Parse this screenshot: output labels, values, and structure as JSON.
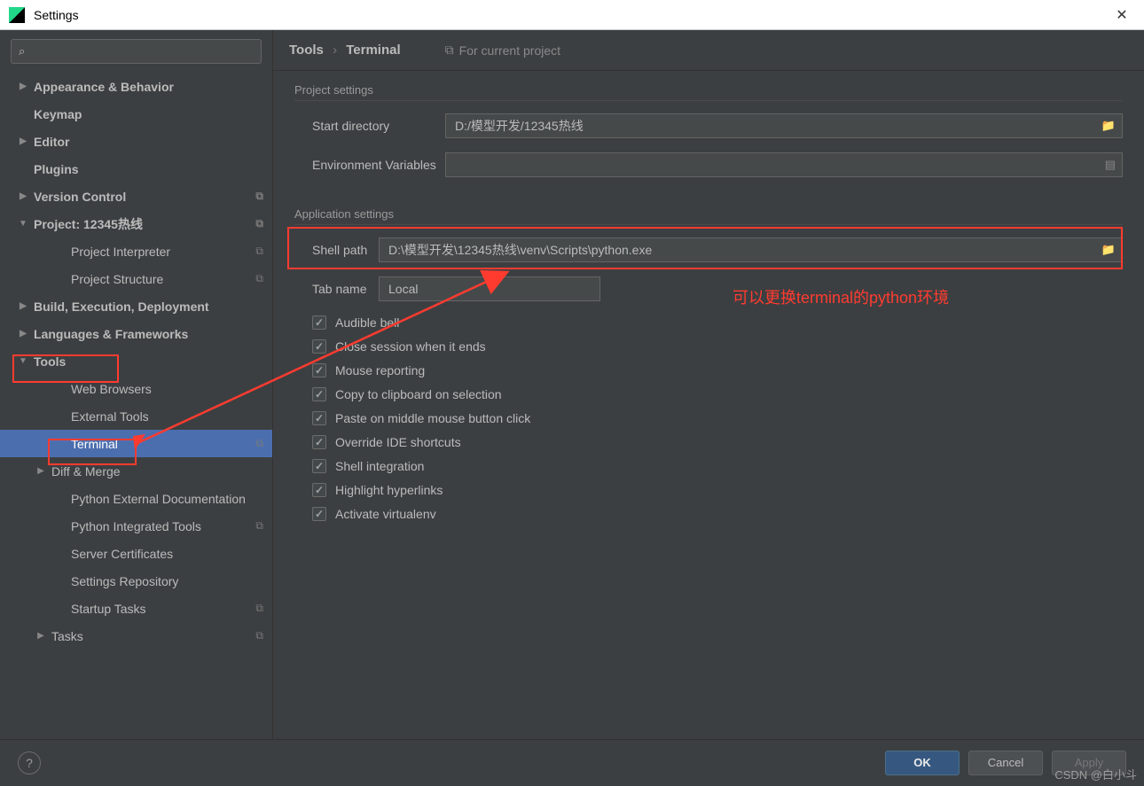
{
  "window": {
    "title": "Settings"
  },
  "search": {
    "placeholder": ""
  },
  "sidebar": {
    "items": [
      {
        "label": "Appearance & Behavior",
        "arrow": "▶",
        "bold": true,
        "pad": 0
      },
      {
        "label": "Keymap",
        "arrow": "",
        "bold": true,
        "pad": 0
      },
      {
        "label": "Editor",
        "arrow": "▶",
        "bold": true,
        "pad": 0
      },
      {
        "label": "Plugins",
        "arrow": "",
        "bold": true,
        "pad": 0
      },
      {
        "label": "Version Control",
        "arrow": "▶",
        "bold": true,
        "pad": 0,
        "copy": true
      },
      {
        "label": "Project: 12345热线",
        "arrow": "▼",
        "bold": true,
        "pad": 0,
        "copy": true
      },
      {
        "label": "Project Interpreter",
        "arrow": "",
        "bold": false,
        "pad": 2,
        "copy": true
      },
      {
        "label": "Project Structure",
        "arrow": "",
        "bold": false,
        "pad": 2,
        "copy": true
      },
      {
        "label": "Build, Execution, Deployment",
        "arrow": "▶",
        "bold": true,
        "pad": 0
      },
      {
        "label": "Languages & Frameworks",
        "arrow": "▶",
        "bold": true,
        "pad": 0
      },
      {
        "label": "Tools",
        "arrow": "▼",
        "bold": true,
        "pad": 0
      },
      {
        "label": "Web Browsers",
        "arrow": "",
        "bold": false,
        "pad": 2
      },
      {
        "label": "External Tools",
        "arrow": "",
        "bold": false,
        "pad": 2
      },
      {
        "label": "Terminal",
        "arrow": "",
        "bold": false,
        "pad": 2,
        "copy": true,
        "selected": true
      },
      {
        "label": "Diff & Merge",
        "arrow": "▶",
        "bold": false,
        "pad": 1
      },
      {
        "label": "Python External Documentation",
        "arrow": "",
        "bold": false,
        "pad": 2
      },
      {
        "label": "Python Integrated Tools",
        "arrow": "",
        "bold": false,
        "pad": 2,
        "copy": true
      },
      {
        "label": "Server Certificates",
        "arrow": "",
        "bold": false,
        "pad": 2
      },
      {
        "label": "Settings Repository",
        "arrow": "",
        "bold": false,
        "pad": 2
      },
      {
        "label": "Startup Tasks",
        "arrow": "",
        "bold": false,
        "pad": 2,
        "copy": true
      },
      {
        "label": "Tasks",
        "arrow": "▶",
        "bold": false,
        "pad": 1,
        "copy": true
      }
    ]
  },
  "breadcrumb": {
    "root": "Tools",
    "leaf": "Terminal"
  },
  "scope": {
    "label": "For current project"
  },
  "sections": {
    "project": "Project settings",
    "application": "Application settings"
  },
  "fields": {
    "start_dir_label": "Start directory",
    "start_dir_value": "D:/模型开发/12345热线",
    "env_vars_label": "Environment Variables",
    "env_vars_value": "",
    "shell_path_label": "Shell path",
    "shell_path_value": "D:\\模型开发\\12345热线\\venv\\Scripts\\python.exe",
    "tab_name_label": "Tab name",
    "tab_name_value": "Local"
  },
  "checks": {
    "audible_bell": "Audible bell",
    "close_session": "Close session when it ends",
    "mouse_reporting": "Mouse reporting",
    "copy_clipboard": "Copy to clipboard on selection",
    "paste_middle": "Paste on middle mouse button click",
    "override_ide": "Override IDE shortcuts",
    "shell_integration": "Shell integration",
    "highlight_links": "Highlight hyperlinks",
    "activate_venv": "Activate virtualenv"
  },
  "buttons": {
    "ok": "OK",
    "cancel": "Cancel",
    "apply": "Apply"
  },
  "annotation": {
    "text": "可以更换terminal的python环境"
  },
  "watermark": "CSDN @白小斗"
}
